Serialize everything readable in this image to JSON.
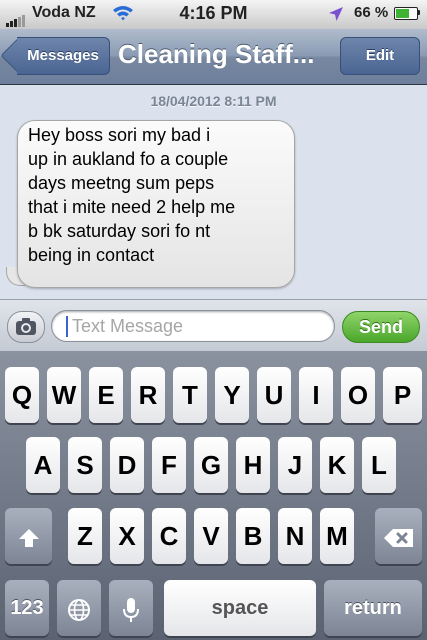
{
  "status_bar": {
    "carrier": "Voda NZ",
    "time": "4:16 PM",
    "battery_percent_label": "66 %",
    "battery_level": 0.66
  },
  "nav": {
    "back_label": "Messages",
    "title": "Cleaning Staff...",
    "edit_label": "Edit"
  },
  "conversation": {
    "timestamp": "18/04/2012 8:11 PM",
    "messages": [
      {
        "from": "received",
        "text": " Hey boss sori my bad i\nup in aukland  fo a couple\ndays meetng sum peps\nthat i mite need 2 help me\nb bk  saturday  sori fo nt\nbeing in contact"
      }
    ]
  },
  "input": {
    "placeholder": "Text Message",
    "send_label": "Send"
  },
  "keyboard": {
    "row1": [
      "Q",
      "W",
      "E",
      "R",
      "T",
      "Y",
      "U",
      "I",
      "O",
      "P"
    ],
    "row2": [
      "A",
      "S",
      "D",
      "F",
      "G",
      "H",
      "J",
      "K",
      "L"
    ],
    "row3": [
      "Z",
      "X",
      "C",
      "V",
      "B",
      "N",
      "M"
    ],
    "numbers_label": "123",
    "space_label": "space",
    "return_label": "return"
  }
}
